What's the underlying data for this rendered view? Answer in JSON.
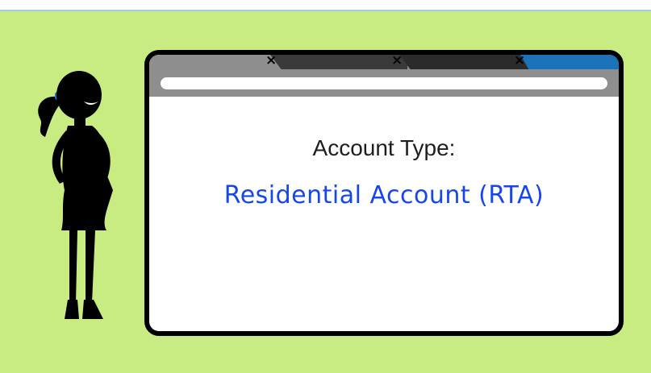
{
  "account": {
    "label": "Account Type:",
    "value": "Residential Account (RTA)"
  },
  "browser": {
    "tab_close_symbol": "×"
  },
  "colors": {
    "background": "#c9ec82",
    "value_text": "#1747e8",
    "active_tab": "#1a72b8"
  }
}
